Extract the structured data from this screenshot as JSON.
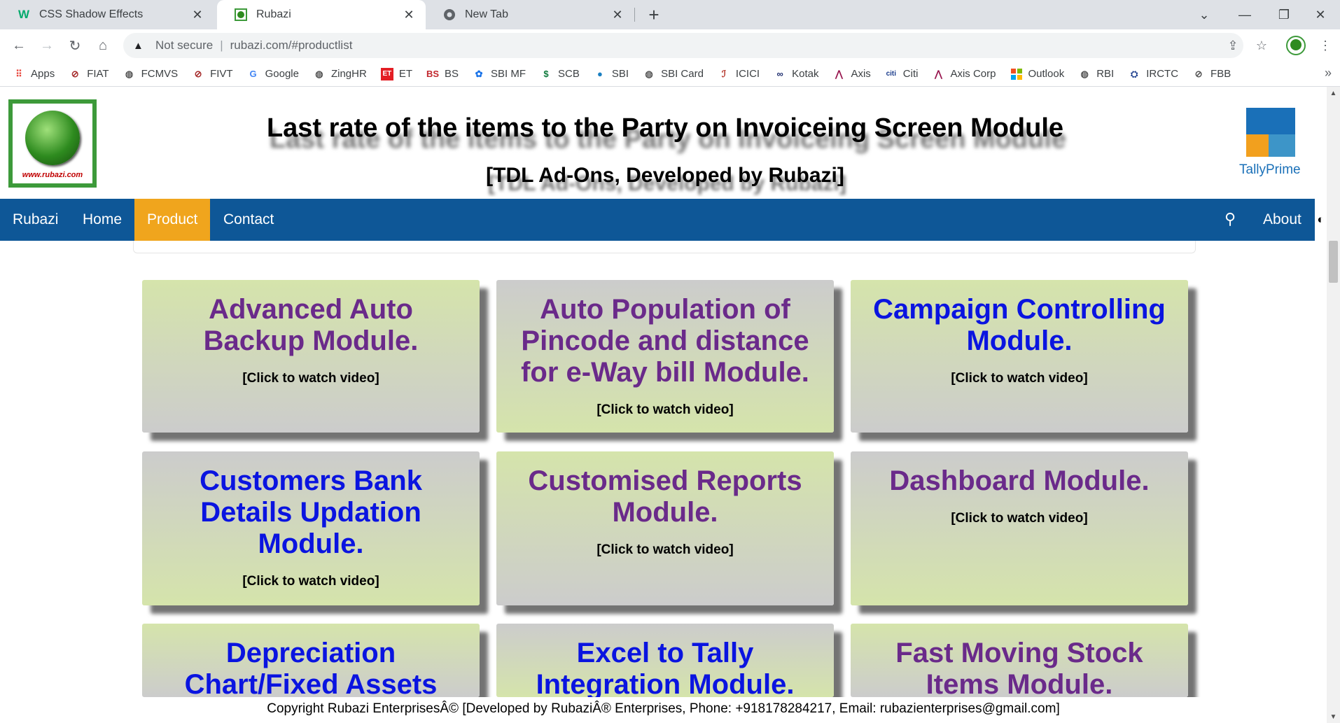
{
  "browser": {
    "tabs": [
      {
        "title": "CSS Shadow Effects",
        "icon": "w3schools-icon"
      },
      {
        "title": "Rubazi",
        "icon": "rubazi-icon"
      },
      {
        "title": "New Tab",
        "icon": "chrome-icon"
      }
    ],
    "address": {
      "security": "Not secure",
      "url": "rubazi.com/#productlist"
    },
    "bookmarks": [
      {
        "label": "Apps",
        "color": "#e8453c"
      },
      {
        "label": "FIAT",
        "color": "#a52a2a"
      },
      {
        "label": "FCMVS",
        "color": "#555555"
      },
      {
        "label": "FIVT",
        "color": "#a52a2a"
      },
      {
        "label": "Google",
        "color": "#4285f4"
      },
      {
        "label": "ZingHR",
        "color": "#555555"
      },
      {
        "label": "ET",
        "color": "#e31e24"
      },
      {
        "label": "BS",
        "color": "#c1272d"
      },
      {
        "label": "SBI MF",
        "color": "#1a73e8"
      },
      {
        "label": "SCB",
        "color": "#0f7a3c"
      },
      {
        "label": "SBI",
        "color": "#1a7fc1"
      },
      {
        "label": "SBI Card",
        "color": "#555555"
      },
      {
        "label": "ICICI",
        "color": "#b02a1f"
      },
      {
        "label": "Kotak",
        "color": "#1a2a6c"
      },
      {
        "label": "Axis",
        "color": "#97144d"
      },
      {
        "label": "Citi",
        "color": "#1a3c8c"
      },
      {
        "label": "Axis Corp",
        "color": "#97144d"
      },
      {
        "label": "Outlook",
        "color": "#f25022"
      },
      {
        "label": "RBI",
        "color": "#555555"
      },
      {
        "label": "IRCTC",
        "color": "#1a3c8c"
      },
      {
        "label": "FBB",
        "color": "#555555"
      }
    ]
  },
  "header": {
    "title": "Last rate of the items to the Party on Invoiceing Screen Module",
    "subtitle": "[TDL Ad-Ons, Developed by Rubazi]",
    "logo_text": "www.rubazi.com",
    "tally_label": "TallyPrime"
  },
  "nav": {
    "brand": "Rubazi",
    "home": "Home",
    "product": "Product",
    "contact": "Contact",
    "about": "About",
    "active_color": "#f0a51d",
    "bar_color": "#0e5797"
  },
  "products": [
    {
      "title": "Advanced Auto Backup Module.",
      "link": "[Click to watch video]"
    },
    {
      "title": "Auto Population of Pincode and distance for e-Way bill Module.",
      "link": "[Click to watch video]"
    },
    {
      "title": "Campaign Controlling Module.",
      "link": "[Click to watch video]"
    },
    {
      "title": "Customers Bank Details Updation Module.",
      "link": "[Click to watch video]"
    },
    {
      "title": "Customised Reports Module.",
      "link": "[Click to watch video]"
    },
    {
      "title": "Dashboard Module.",
      "link": "[Click to watch video]"
    },
    {
      "title": "Depreciation Chart/Fixed Assets",
      "link": ""
    },
    {
      "title": "Excel to Tally Integration Module.",
      "link": ""
    },
    {
      "title": "Fast Moving Stock Items Module.",
      "link": ""
    }
  ],
  "footer": {
    "text": "Copyright Rubazi EnterprisesÂ© [Developed by RubaziÂ® Enterprises, Phone: +918178284217, Email: rubazienterprises@gmail.com]"
  }
}
